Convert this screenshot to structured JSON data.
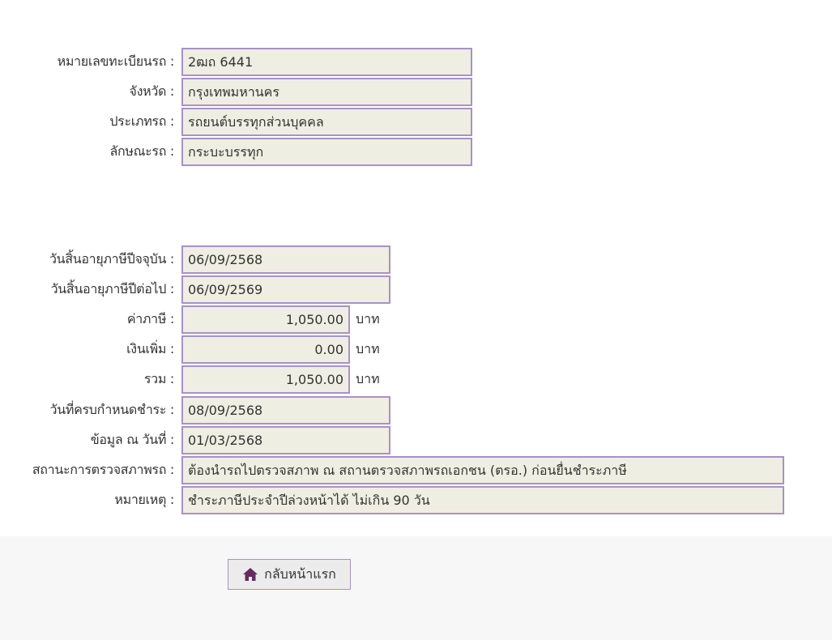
{
  "vehicle": {
    "plate_label": "หมายเลขทะเบียนรถ :",
    "plate_value": "2ฒถ 6441",
    "province_label": "จังหวัด :",
    "province_value": "กรุงเทพมหานคร",
    "type_label": "ประเภทรถ :",
    "type_value": "รถยนต์บรรทุกส่วนบุคคล",
    "body_label": "ลักษณะรถ :",
    "body_value": "กระบะบรรทุก"
  },
  "tax": {
    "current_expiry_label": "วันสิ้นอายุภาษีปีจจุบัน :",
    "current_expiry_value": "06/09/2568",
    "next_expiry_label": "วันสิ้นอายุภาษีปีต่อไป :",
    "next_expiry_value": "06/09/2569",
    "fee_label": "ค่าภาษี :",
    "fee_value": "1,050.00",
    "surcharge_label": "เงินเพิ่ม :",
    "surcharge_value": "0.00",
    "total_label": "รวม :",
    "total_value": "1,050.00",
    "currency_unit": "บาท",
    "due_date_label": "วันที่ครบกำหนดชำระ :",
    "due_date_value": "08/09/2568",
    "data_as_of_label": "ข้อมูล ณ วันที่ :",
    "data_as_of_value": "01/03/2568",
    "inspection_label": "สถานะการตรวจสภาพรถ :",
    "inspection_value": "ต้องนำรถไปตรวจสภาพ ณ สถานตรวจสภาพรถเอกชน (ตรอ.) ก่อนยื่นชำระภาษี",
    "remark_label": "หมายเหตุ :",
    "remark_value": "ชำระภาษีประจำปีล่วงหน้าได้ ไม่เกิน 90 วัน"
  },
  "footer": {
    "home_button_label": "กลับหน้าแรก",
    "home_icon": "home-icon"
  },
  "colors": {
    "field_background": "#efeee2",
    "field_border": "#a991c9",
    "icon": "#6a2a63"
  }
}
